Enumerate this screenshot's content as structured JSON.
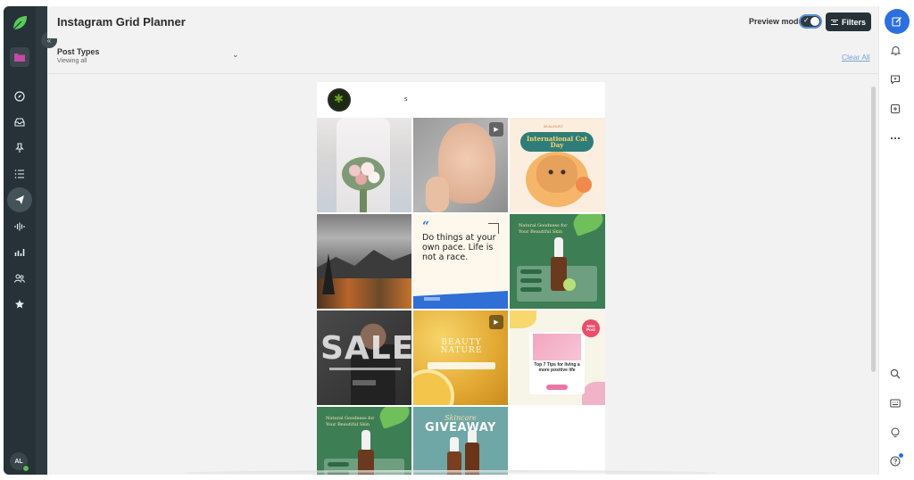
{
  "app": {
    "title": "Instagram Grid Planner"
  },
  "header": {
    "preview_mode_label": "Preview mode",
    "filters_label": "Filters"
  },
  "filters_bar": {
    "post_types_label": "Post Types",
    "post_types_value": "Viewing all",
    "clear_all_label": "Clear All"
  },
  "user": {
    "initials": "AL"
  },
  "left_nav": {
    "icons": [
      "logo-leaf-icon",
      "folder-icon",
      "compass-icon",
      "inbox-icon",
      "pin-icon",
      "list-icon",
      "send-icon",
      "audio-wave-icon",
      "bar-chart-icon",
      "people-icon",
      "star-icon"
    ]
  },
  "right_nav": {
    "icons": [
      "compose-icon",
      "bell-icon",
      "chat-icon",
      "add-box-icon",
      "more-icon",
      "search-icon",
      "keyboard-icon",
      "lightbulb-icon",
      "help-icon"
    ]
  },
  "grid": {
    "profile_marker": "s",
    "tiles": {
      "cat_day": {
        "banner": "International Cat Day",
        "eyebrow": "08 AUGUST"
      },
      "quote": {
        "mark": "“",
        "text": "Do things at your own pace. Life is not a race."
      },
      "serum": {
        "text": "Natural Goodness for Your Beautiful Skin"
      },
      "sale": {
        "text": "SALE"
      },
      "lemon": {
        "text": "BEAUTY NATURE"
      },
      "tips": {
        "text": "Top 7 Tips for living a more positive life",
        "badge": "New Post"
      },
      "giveaway": {
        "script": "Skincare",
        "word": "GIVEAWAY"
      }
    }
  },
  "colors": {
    "rail": "#263238",
    "compose": "#2e6fe0",
    "accent_link": "#7aa3d6"
  }
}
